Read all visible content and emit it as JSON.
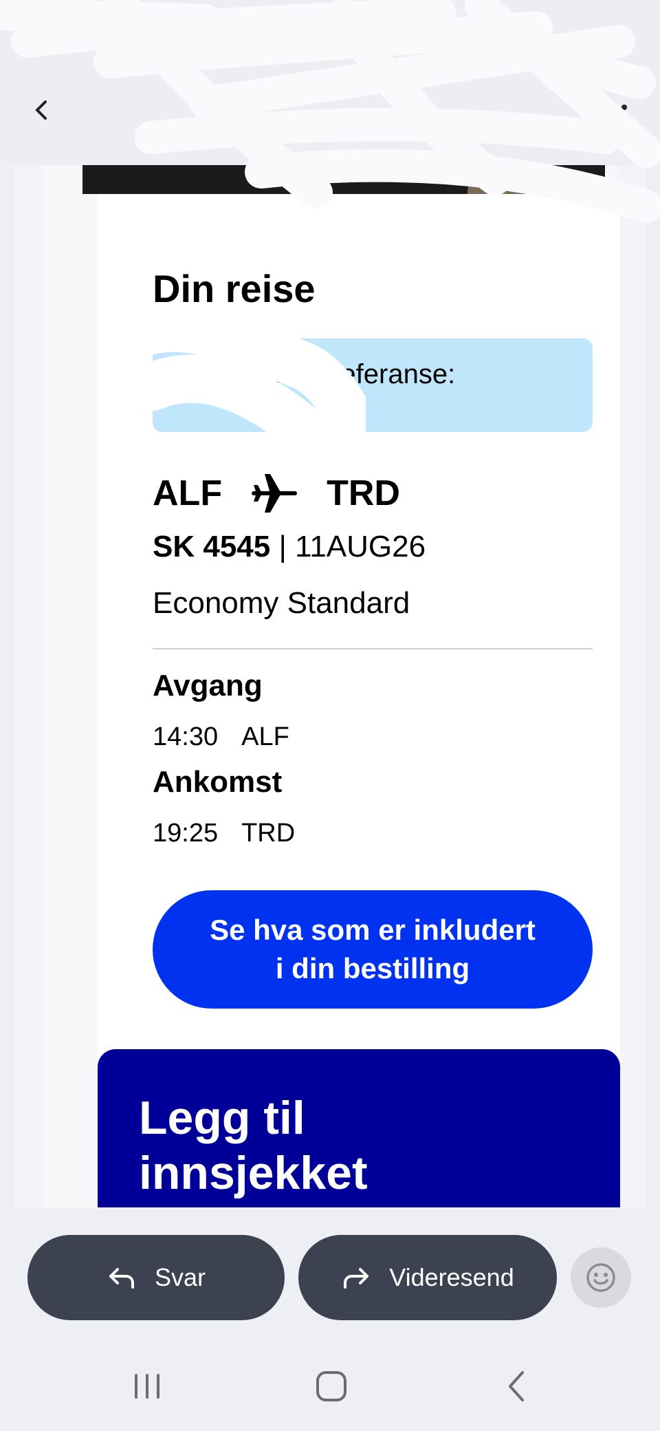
{
  "topbar": {
    "back_icon": "back-arrow-icon",
    "more_icon": "more-vertical-icon"
  },
  "email": {
    "card_title": "Din reise",
    "booking_ref_label": "Bestillingsreferanse:",
    "route": {
      "from": "ALF",
      "to": "TRD",
      "icon": "airplane-icon"
    },
    "flight_number": "SK 4545",
    "flight_separator": " | ",
    "flight_date": "11AUG26",
    "cabin": "Economy Standard",
    "departure": {
      "label": "Avgang",
      "time": "14:30",
      "airport": "ALF"
    },
    "arrival": {
      "label": "Ankomst",
      "time": "19:25",
      "airport": "TRD"
    },
    "cta_line1": "Se hva som er inkludert",
    "cta_line2": "i din bestilling",
    "promo_title": "Legg til innsjekket"
  },
  "actions": {
    "reply_label": "Svar",
    "forward_label": "Videresend",
    "emoji_icon": "emoji-icon"
  },
  "colors": {
    "cta": "#0032f0",
    "promo": "#000099",
    "ref_box": "#bfe6fb",
    "action_pill": "#3d4250"
  }
}
